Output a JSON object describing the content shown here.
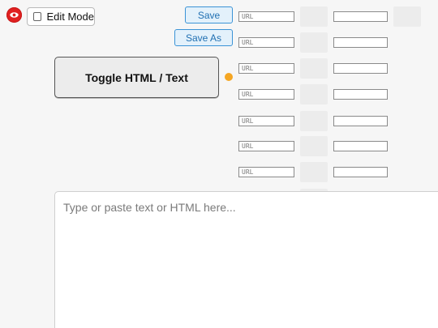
{
  "logo": {
    "icon": "eye-icon",
    "color": "#e02020"
  },
  "edit_mode": {
    "label": "Edit Mode",
    "checked": false
  },
  "toolbar": {
    "save_label": "Save",
    "save_as_label": "Save As"
  },
  "toggle_button": {
    "label": "Toggle HTML / Text"
  },
  "status": {
    "color": "#f5a623"
  },
  "rows": [
    {
      "url_placeholder": "URL",
      "text_value": ""
    },
    {
      "url_placeholder": "URL",
      "text_value": ""
    },
    {
      "url_placeholder": "URL",
      "text_value": ""
    },
    {
      "url_placeholder": "URL",
      "text_value": ""
    },
    {
      "url_placeholder": "URL",
      "text_value": ""
    },
    {
      "url_placeholder": "URL",
      "text_value": ""
    },
    {
      "url_placeholder": "URL",
      "text_value": ""
    }
  ],
  "editor": {
    "placeholder": "Type or paste text or HTML here..."
  },
  "colors": {
    "accent_blue": "#3b93d6",
    "accent_blue_bg": "#e3f1fb",
    "page_bg": "#f6f6f6",
    "cell_gray": "#ececec"
  }
}
